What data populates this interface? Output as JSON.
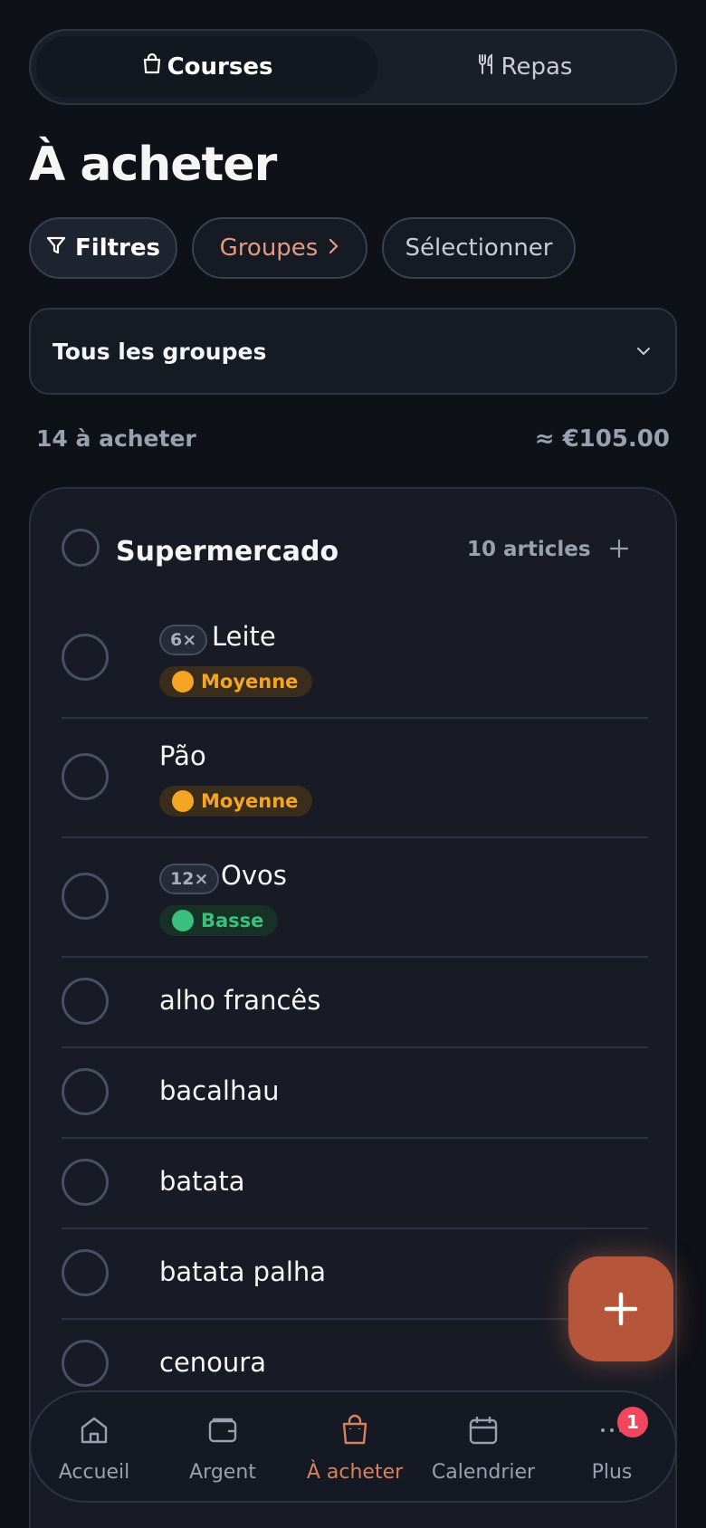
{
  "segmented": {
    "active_label": "Courses",
    "active_icon": "bag-icon",
    "inactive_label": "Repas",
    "inactive_icon": "utensils-icon"
  },
  "page_title": "À acheter",
  "chips": {
    "filters": "Filtres",
    "groups": "Groupes",
    "select": "Sélectionner"
  },
  "dropdown": {
    "selected": "Tous les groupes"
  },
  "summary": {
    "count": "14 à acheter",
    "total": "≈ €105.00"
  },
  "group": {
    "name": "Supermercado",
    "count": "10 articles",
    "items": [
      {
        "name": "Leite",
        "qty": "6×",
        "priority": "Moyenne"
      },
      {
        "name": "Pão",
        "priority": "Moyenne"
      },
      {
        "name": "Ovos",
        "qty": "12×",
        "priority": "Basse"
      },
      {
        "name": "alho francês"
      },
      {
        "name": "bacalhau"
      },
      {
        "name": "batata"
      },
      {
        "name": "batata palha"
      },
      {
        "name": "cenoura"
      }
    ]
  },
  "nav": {
    "home": "Accueil",
    "money": "Argent",
    "shopping": "À acheter",
    "calendar": "Calendrier",
    "more": "Plus",
    "more_badge": "1"
  },
  "colors": {
    "background": "#0e1117",
    "accent": "#b5563a",
    "priority_medium": "#f5a524",
    "priority_low": "#3bbf7d",
    "badge": "#f0475e"
  }
}
